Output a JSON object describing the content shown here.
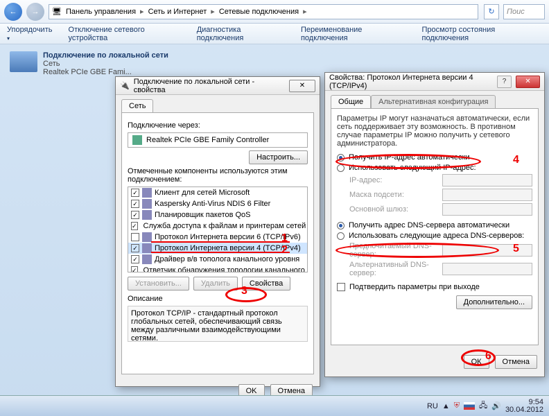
{
  "breadcrumb": {
    "root": "Панель управления",
    "l2": "Сеть и Интернет",
    "l3": "Сетевые подключения"
  },
  "search_placeholder": "Поис",
  "commands": {
    "organize": "Упорядочить",
    "disable": "Отключение сетевого устройства",
    "diag": "Диагностика подключения",
    "rename": "Переименование подключения",
    "status": "Просмотр состояния подключения"
  },
  "netitem": {
    "name": "Подключение по локальной сети",
    "type": "Сеть",
    "adapter": "Realtek PCIe GBE Fami..."
  },
  "dlg1": {
    "title": "Подключение по локальной сети - свойства",
    "tab": "Сеть",
    "connect_via": "Подключение через:",
    "adapter": "Realtek PCIe GBE Family Controller",
    "configure": "Настроить...",
    "components_label": "Отмеченные компоненты используются этим подключением:",
    "items": [
      {
        "c": true,
        "t": "Клиент для сетей Microsoft"
      },
      {
        "c": true,
        "t": "Kaspersky Anti-Virus NDIS 6 Filter"
      },
      {
        "c": true,
        "t": "Планировщик пакетов QoS"
      },
      {
        "c": true,
        "t": "Служба доступа к файлам и принтерам сетей Micro..."
      },
      {
        "c": false,
        "t": "Протокол Интернета версии 6 (TCP/IPv6)"
      },
      {
        "c": true,
        "t": "Протокол Интернета версии 4 (TCP/IPv4)",
        "sel": true
      },
      {
        "c": true,
        "t": "Драйвер в/в тополога канального уровня"
      },
      {
        "c": true,
        "t": "Ответчик обнаружения топологии канального уровня"
      }
    ],
    "install": "Установить...",
    "remove": "Удалить",
    "props": "Свойства",
    "desc_label": "Описание",
    "desc": "Протокол TCP/IP - стандартный протокол глобальных сетей, обеспечивающий связь между различными взаимодействующими сетями.",
    "ok": "OK",
    "cancel": "Отмена"
  },
  "dlg2": {
    "title": "Свойства: Протокол Интернета версии 4 (TCP/IPv4)",
    "tab1": "Общие",
    "tab2": "Альтернативная конфигурация",
    "info": "Параметры IP могут назначаться автоматически, если сеть поддерживает эту возможность. В противном случае параметры IP можно получить у сетевого администратора.",
    "r_ip_auto": "Получить IP-адрес автоматически",
    "r_ip_manual": "Использовать следующий IP-адрес:",
    "f_ip": "IP-адрес:",
    "f_mask": "Маска подсети:",
    "f_gw": "Основной шлюз:",
    "r_dns_auto": "Получить адрес DNS-сервера автоматически",
    "r_dns_manual": "Использовать следующие адреса DNS-серверов:",
    "f_dns1": "Предпочитаемый DNS-сервер:",
    "f_dns2": "Альтернативный DNS-сервер:",
    "confirm": "Подтвердить параметры при выходе",
    "advanced": "Дополнительно...",
    "ok": "ОК",
    "cancel": "Отмена"
  },
  "tray": {
    "lang": "RU",
    "time": "9:54",
    "date": "30.04.2012"
  }
}
